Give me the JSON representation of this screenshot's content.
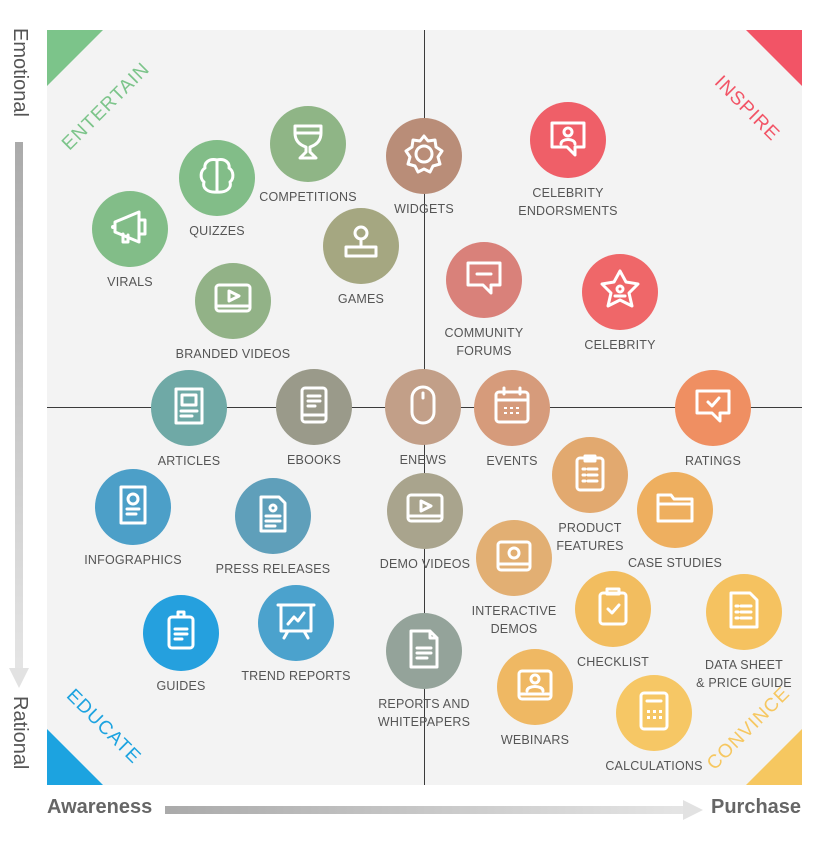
{
  "axes": {
    "y_top": "Emotional",
    "y_bottom": "Rational",
    "x_left": "Awareness",
    "x_right": "Purchase"
  },
  "quadrants": {
    "top_left": {
      "label": "ENTERTAIN",
      "color": "#7cc48a"
    },
    "top_right": {
      "label": "INSPIRE",
      "color": "#f25466"
    },
    "bottom_left": {
      "label": "EDUCATE",
      "color": "#1ca3e0"
    },
    "bottom_right": {
      "label": "CONVINCE",
      "color": "#f6c760"
    }
  },
  "items": [
    {
      "id": "virals",
      "label": "VIRALS",
      "icon": "megaphone-icon",
      "color": "#82bd88",
      "quadrant": "entertain"
    },
    {
      "id": "quizzes",
      "label": "QUIZZES",
      "icon": "brain-icon",
      "color": "#82bd88",
      "quadrant": "entertain"
    },
    {
      "id": "competitions",
      "label": "COMPETITIONS",
      "icon": "trophy-icon",
      "color": "#8fb586",
      "quadrant": "entertain"
    },
    {
      "id": "games",
      "label": "GAMES",
      "icon": "joystick-icon",
      "color": "#a5a781",
      "quadrant": "entertain"
    },
    {
      "id": "branded-videos",
      "label": "BRANDED VIDEOS",
      "icon": "video-play-icon",
      "color": "#92b287",
      "quadrant": "entertain"
    },
    {
      "id": "widgets",
      "label": "WIDGETS",
      "icon": "gear-icon",
      "color": "#b98d78",
      "quadrant": "center-top"
    },
    {
      "id": "celebrity-endorsments",
      "label": "CELEBRITY\nENDORSMENTS",
      "icon": "person-speech-icon",
      "color": "#ef5f68",
      "quadrant": "inspire"
    },
    {
      "id": "community-forums",
      "label": "COMMUNITY\nFORUMS",
      "icon": "chat-bubble-icon",
      "color": "#d9817a",
      "quadrant": "inspire"
    },
    {
      "id": "celebrity",
      "label": "CELEBRITY",
      "icon": "star-person-icon",
      "color": "#ef6769",
      "quadrant": "inspire"
    },
    {
      "id": "articles",
      "label": "ARTICLES",
      "icon": "article-icon",
      "color": "#6fa9a6",
      "quadrant": "center-left"
    },
    {
      "id": "ebooks",
      "label": "EBOOKS",
      "icon": "ebook-icon",
      "color": "#9a9a8a",
      "quadrant": "center-left"
    },
    {
      "id": "enews",
      "label": "ENEWS",
      "icon": "mouse-icon",
      "color": "#c29f88",
      "quadrant": "center"
    },
    {
      "id": "events",
      "label": "EVENTS",
      "icon": "calendar-icon",
      "color": "#d69b7b",
      "quadrant": "center-right"
    },
    {
      "id": "ratings",
      "label": "RATINGS",
      "icon": "check-bubble-icon",
      "color": "#ef8f62",
      "quadrant": "center-right"
    },
    {
      "id": "product-features",
      "label": "PRODUCT\nFEATURES",
      "icon": "clipboard-list-icon",
      "color": "#e2a96f",
      "quadrant": "convince"
    },
    {
      "id": "case-studies",
      "label": "CASE STUDIES",
      "icon": "folder-icon",
      "color": "#eeaf5f",
      "quadrant": "convince"
    },
    {
      "id": "infographics",
      "label": "INFOGRAPHICS",
      "icon": "infographic-icon",
      "color": "#4c9fc8",
      "quadrant": "educate"
    },
    {
      "id": "press-releases",
      "label": "PRESS RELEASES",
      "icon": "press-document-icon",
      "color": "#5f9fba",
      "quadrant": "educate"
    },
    {
      "id": "demo-videos",
      "label": "DEMO VIDEOS",
      "icon": "video-play-icon",
      "color": "#a9a48d",
      "quadrant": "center-bottom"
    },
    {
      "id": "interactive-demos",
      "label": "INTERACTIVE\nDEMOS",
      "icon": "monitor-circle-icon",
      "color": "#e2af73",
      "quadrant": "convince"
    },
    {
      "id": "checklist",
      "label": "CHECKLIST",
      "icon": "clipboard-check-icon",
      "color": "#f2bd5f",
      "quadrant": "convince"
    },
    {
      "id": "data-sheet",
      "label": "DATA SHEET\n& PRICE GUIDE",
      "icon": "document-list-icon",
      "color": "#f5c260",
      "quadrant": "convince"
    },
    {
      "id": "guides",
      "label": "GUIDES",
      "icon": "guide-icon",
      "color": "#25a0de",
      "quadrant": "educate"
    },
    {
      "id": "trend-reports",
      "label": "TREND REPORTS",
      "icon": "presentation-chart-icon",
      "color": "#4ba2cd",
      "quadrant": "educate"
    },
    {
      "id": "reports-whitepapers",
      "label": "REPORTS AND\nWHITEPAPERS",
      "icon": "document-icon",
      "color": "#94a39a",
      "quadrant": "center-bottom"
    },
    {
      "id": "webinars",
      "label": "WEBINARS",
      "icon": "monitor-person-icon",
      "color": "#efb863",
      "quadrant": "convince"
    },
    {
      "id": "calculations",
      "label": "CALCULATIONS",
      "icon": "calculator-icon",
      "color": "#f6c765",
      "quadrant": "convince"
    }
  ]
}
